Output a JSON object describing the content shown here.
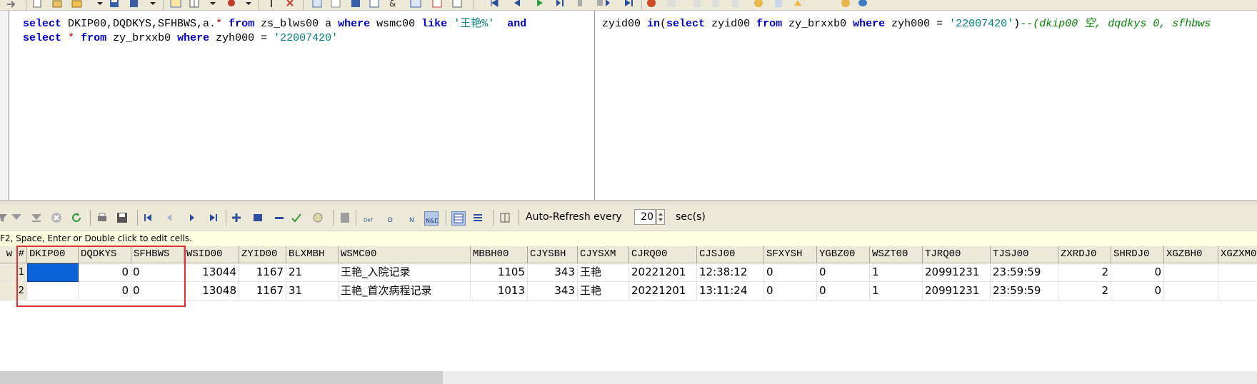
{
  "editor": {
    "line1": {
      "kw_select": "select",
      "cols": " DKIP00,DQDKYS,SFHBWS,a.",
      "star": "*",
      "kw_from": "from",
      "t1": " zs_blws00 a ",
      "kw_where": "where",
      "t2": " wsmc00 ",
      "kw_like": "like",
      "lit": "'王艳%'",
      "kw_and": "and",
      "t3": " zyid00 ",
      "kw_in": "in",
      "t4": "(",
      "kw_select2": "select",
      "t5": " zyid00 ",
      "kw_from2": "from",
      "t6": " zy_brxxb0 ",
      "kw_where2": "where",
      "t7": " zyh000 = ",
      "lit2": "'22007420'",
      "t8": ")",
      "comment": "--(dkip00 空, dqdkys 0, sfhbws"
    },
    "line2": {
      "kw_select": "select",
      "star": "*",
      "kw_from": "from",
      "t1": " zy_brxxb0 ",
      "kw_where": "where",
      "t2": " zyh000 = ",
      "lit": "'22007420'"
    }
  },
  "toolbar": {
    "auto_refresh_label": "Auto-Refresh every",
    "auto_refresh_value": "20",
    "auto_refresh_unit": "sec(s)",
    "icons": [
      "filter-icon",
      "filter-clear-icon",
      "cancel-icon",
      "refresh-icon",
      "print-icon",
      "save-icon",
      "first-record-icon",
      "prior-record-icon",
      "next-record-icon",
      "last-record-icon",
      "insert-record-icon",
      "insert-multiple-icon",
      "delete-record-icon",
      "post-icon",
      "cancel-edit-icon",
      "calculator-icon",
      "default-icon",
      "d-icon",
      "n-icon",
      "nd-icon",
      "grid-view-icon",
      "record-view-icon",
      "fit-columns-icon"
    ]
  },
  "hint": "F2, Space, Enter or Double click to edit cells.",
  "grid": {
    "row_header": "w #",
    "columns": [
      "DKIP00",
      "DQDKYS",
      "SFHBWS",
      "WSID00",
      "ZYID00",
      "BLXMBH",
      "WSMC00",
      "MBBH00",
      "CJYSBH",
      "CJYSXM",
      "CJRQ00",
      "CJSJ00",
      "SFXYSH",
      "YGBZ00",
      "WSZT00",
      "TJRQ00",
      "TJSJ00",
      "ZXRDJ0",
      "SHRDJ0",
      "XGZBH0",
      "XGZXM0"
    ],
    "rows": [
      {
        "num": "1",
        "DKIP00": "",
        "DQDKYS": "0",
        "SFHBWS": "0",
        "WSID00": "13044",
        "ZYID00": "1167",
        "BLXMBH": "21",
        "WSMC00": "王艳_入院记录",
        "MBBH00": "1105",
        "CJYSBH": "343",
        "CJYSXM": "王艳",
        "CJRQ00": "20221201",
        "CJSJ00": "12:38:12",
        "SFXYSH": "0",
        "YGBZ00": "0",
        "WSZT00": "1",
        "TJRQ00": "20991231",
        "TJSJ00": "23:59:59",
        "ZXRDJ0": "2",
        "SHRDJ0": "0",
        "XGZBH0": "",
        "XGZXM0": ""
      },
      {
        "num": "2",
        "DKIP00": "",
        "DQDKYS": "0",
        "SFHBWS": "0",
        "WSID00": "13048",
        "ZYID00": "1167",
        "BLXMBH": "31",
        "WSMC00": "王艳_首次病程记录",
        "MBBH00": "1013",
        "CJYSBH": "343",
        "CJYSXM": "王艳",
        "CJRQ00": "20221201",
        "CJSJ00": "13:11:24",
        "SFXYSH": "0",
        "YGBZ00": "0",
        "WSZT00": "1",
        "TJRQ00": "20991231",
        "TJSJ00": "23:59:59",
        "ZXRDJ0": "2",
        "SHRDJ0": "0",
        "XGZBH0": "",
        "XGZXM0": ""
      }
    ]
  },
  "colors": {
    "selected_cell": "#0a64d8",
    "highlight_box": "#e03030",
    "toolbar_bg": "#ece9d8"
  }
}
